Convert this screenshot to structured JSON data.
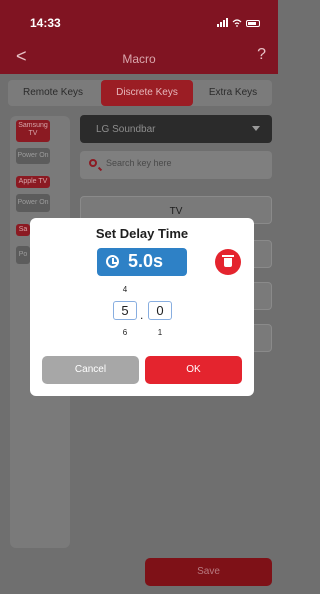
{
  "status": {
    "time": "14:33"
  },
  "nav": {
    "back": "<",
    "title": "Macro",
    "help": "?"
  },
  "tabs": [
    {
      "label": "Remote Keys"
    },
    {
      "label": "Discrete Keys"
    },
    {
      "label": "Extra Keys"
    }
  ],
  "devices": [
    {
      "name": "Samsung TV",
      "button": "Power On"
    },
    {
      "name": "Apple TV",
      "button": "Power On"
    },
    {
      "name": "Sa",
      "button": "Po"
    }
  ],
  "main": {
    "device_select": "LG Soundbar",
    "search_placeholder": "Search key here",
    "keys": [
      "TV"
    ]
  },
  "dialog": {
    "title": "Set Delay Time",
    "delay_display": "5.0s",
    "picker": {
      "integer": {
        "above": "4",
        "value": "5",
        "below": "6"
      },
      "decimal": {
        "value": "0",
        "below": "1"
      },
      "separator": "."
    },
    "cancel_label": "Cancel",
    "ok_label": "OK"
  },
  "footer": {
    "save_label": "Save"
  },
  "colors": {
    "brand": "#801422",
    "accent_blue": "#2e81c6",
    "danger": "#e4242e"
  }
}
